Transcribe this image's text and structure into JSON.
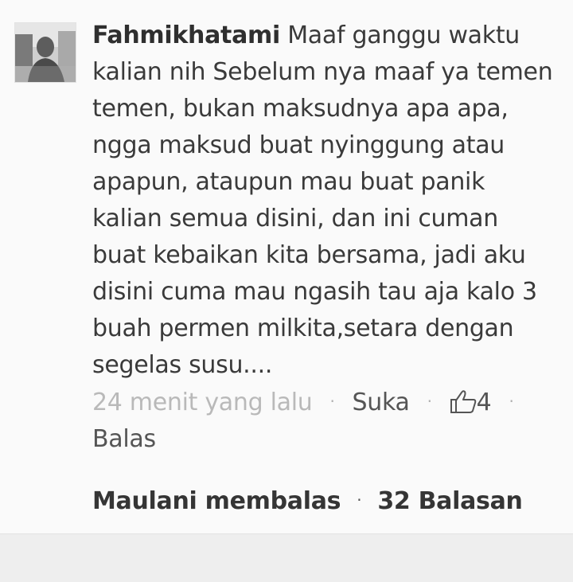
{
  "comment": {
    "author": "Fahmikhatami",
    "text": "Maaf ganggu waktu kalian nih Sebelum nya maaf ya temen temen, bukan maksudnya apa apa, ngga maksud buat nyinggung atau apapun, ataupun mau buat panik kalian semua disini, dan ini cuman buat kebaikan kita bersama, jadi aku disini cuma mau ngasih tau aja kalo 3 buah permen milkita,setara dengan segelas susu....",
    "timestamp": "24 menit yang lalu",
    "like_label": "Suka",
    "like_count": "4",
    "reply_label": "Balas",
    "separator": "·",
    "icons": {
      "avatar": "user-avatar",
      "like": "thumbs-up-icon"
    }
  },
  "replies": {
    "last_replier": "Maulani membalas",
    "count_label": "32 Balasan"
  }
}
